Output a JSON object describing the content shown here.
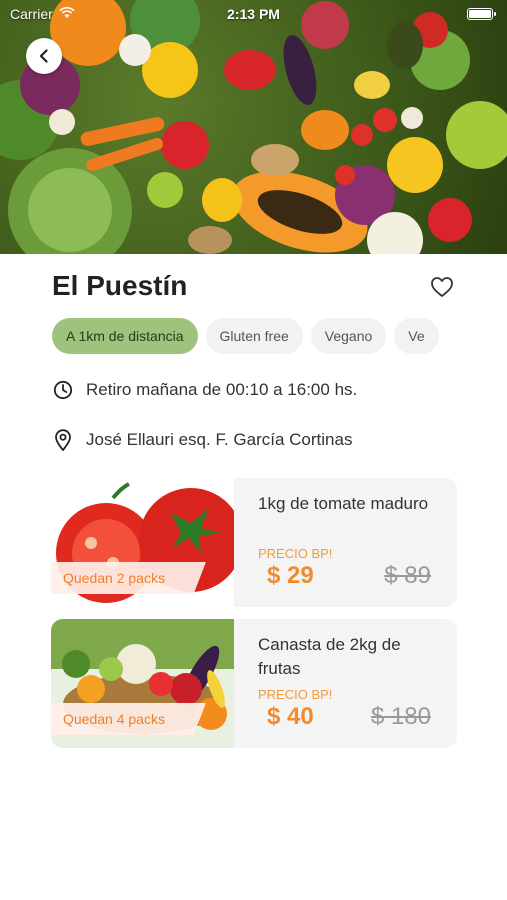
{
  "status": {
    "carrier": "Carrier",
    "time": "2:13 PM"
  },
  "store": {
    "name": "El Puestín",
    "tags": [
      {
        "label": "A 1km de distancia",
        "active": true
      },
      {
        "label": "Gluten free",
        "active": false
      },
      {
        "label": "Vegano",
        "active": false
      },
      {
        "label": "Ve",
        "active": false
      }
    ],
    "pickup": "Retiro mañana de 00:10 a 16:00 hs.",
    "address": "José Ellauri esq. F. García Cortinas"
  },
  "products": [
    {
      "name": "1kg de tomate maduro",
      "packs": "Quedan 2 packs",
      "price_label": "PRECIO BP!",
      "price": "$ 29",
      "old_price": "$ 89"
    },
    {
      "name": "Canasta de 2kg de frutas",
      "packs": "Quedan 4 packs",
      "price_label": "PRECIO BP!",
      "price": "$ 40",
      "old_price": "$ 180"
    }
  ],
  "colors": {
    "accent": "#9fc27c",
    "price": "#f28a2e",
    "ribbon_text": "#f07f2a"
  },
  "icons": [
    "back-chevron-icon",
    "heart-icon",
    "clock-icon",
    "location-pin-icon",
    "wifi-icon",
    "battery-icon"
  ]
}
